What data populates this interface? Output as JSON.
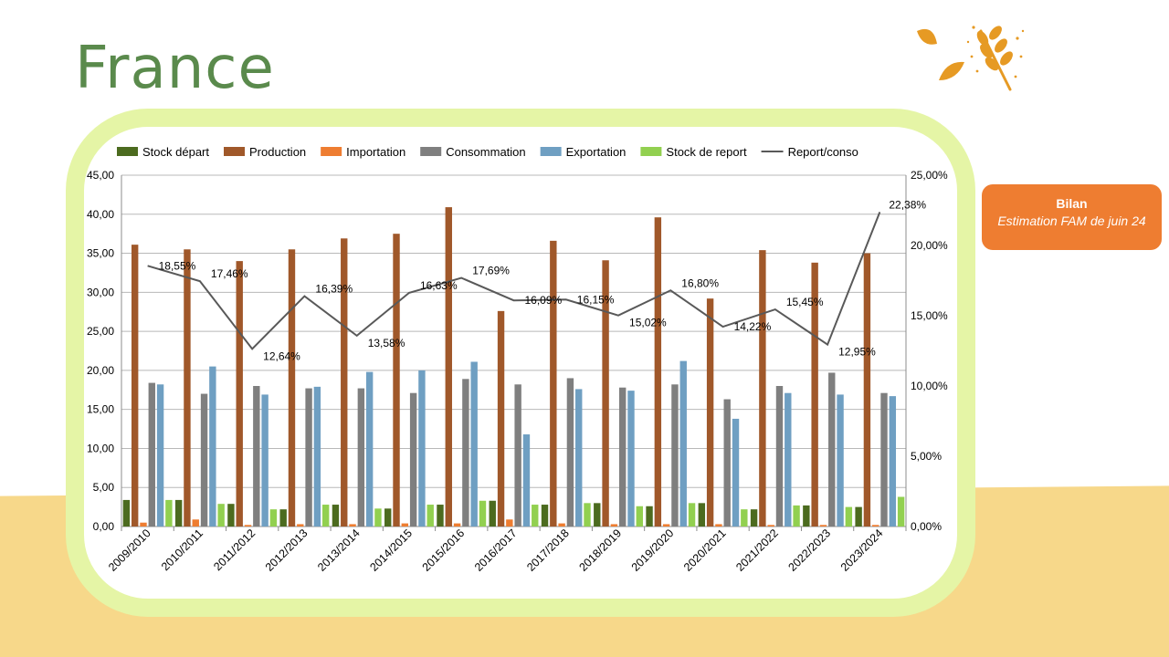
{
  "page": {
    "title": "France"
  },
  "badge": {
    "title": "Bilan",
    "subtitle": "Estimation  FAM de juin 24"
  },
  "icons": {
    "logo": "wheat-leaf-logo-icon"
  },
  "colors": {
    "title": "#5a8a4c",
    "frame": "#e5f5a6",
    "badge": "#ee7d31",
    "band": "#f7d88a"
  },
  "chart_data": {
    "type": "bar",
    "categories": [
      "2009/2010",
      "2010/2011",
      "2011/2012",
      "2012/2013",
      "2013/2014",
      "2014/2015",
      "2015/2016",
      "2016/2017",
      "2017/2018",
      "2018/2019",
      "2019/2020",
      "2020/2021",
      "2021/2022",
      "2022/2023",
      "2023/2024"
    ],
    "series": [
      {
        "name": "Stock départ",
        "color": "#4c6b1f",
        "values": [
          3.4,
          3.4,
          2.9,
          2.2,
          2.8,
          2.3,
          2.8,
          3.3,
          2.8,
          3.0,
          2.6,
          3.0,
          2.2,
          2.7,
          2.5
        ]
      },
      {
        "name": "Production",
        "color": "#a0582a",
        "values": [
          36.1,
          35.5,
          34.0,
          35.5,
          36.9,
          37.5,
          40.9,
          27.6,
          36.6,
          34.1,
          39.6,
          29.2,
          35.4,
          33.8,
          35.0
        ]
      },
      {
        "name": "Importation",
        "color": "#ee7d31",
        "values": [
          0.5,
          0.9,
          0.2,
          0.3,
          0.3,
          0.4,
          0.4,
          0.9,
          0.4,
          0.3,
          0.3,
          0.3,
          0.2,
          0.2,
          0.2
        ]
      },
      {
        "name": "Consommation",
        "color": "#7f7f7f",
        "values": [
          18.4,
          17.0,
          18.0,
          17.7,
          17.7,
          17.1,
          18.9,
          18.2,
          19.0,
          17.8,
          18.2,
          16.3,
          18.0,
          19.7,
          17.1
        ]
      },
      {
        "name": "Exportation",
        "color": "#6f9fc2",
        "values": [
          18.2,
          20.5,
          16.9,
          17.9,
          19.8,
          20.0,
          21.1,
          11.8,
          17.6,
          17.4,
          21.2,
          13.8,
          17.1,
          16.9,
          16.7
        ]
      },
      {
        "name": "Stock de report",
        "color": "#92d050",
        "values": [
          3.4,
          2.9,
          2.2,
          2.8,
          2.3,
          2.8,
          3.3,
          2.8,
          3.0,
          2.6,
          3.0,
          2.2,
          2.7,
          2.5,
          3.8
        ]
      }
    ],
    "line_series": {
      "name": "Report/conso",
      "color": "#595959",
      "values": [
        18.55,
        17.46,
        12.64,
        16.39,
        13.58,
        16.63,
        17.69,
        16.09,
        16.15,
        15.02,
        16.8,
        14.22,
        15.45,
        12.95,
        22.38
      ],
      "labels": [
        "18,55%",
        "17,46%",
        "12,64%",
        "16,39%",
        "13,58%",
        "16,63%",
        "17,69%",
        "16,09%",
        "16,15%",
        "15,02%",
        "16,80%",
        "14,22%",
        "15,45%",
        "12,95%",
        "22,38%"
      ]
    },
    "y_left": {
      "min": 0,
      "max": 45,
      "ticks": [
        "0,00",
        "5,00",
        "10,00",
        "15,00",
        "20,00",
        "25,00",
        "30,00",
        "35,00",
        "40,00",
        "45,00"
      ]
    },
    "y_right": {
      "min": 0,
      "max": 25,
      "ticks": [
        "0,00%",
        "5,00%",
        "10,00%",
        "15,00%",
        "20,00%",
        "25,00%"
      ]
    },
    "grid": true,
    "legend_position": "top"
  }
}
